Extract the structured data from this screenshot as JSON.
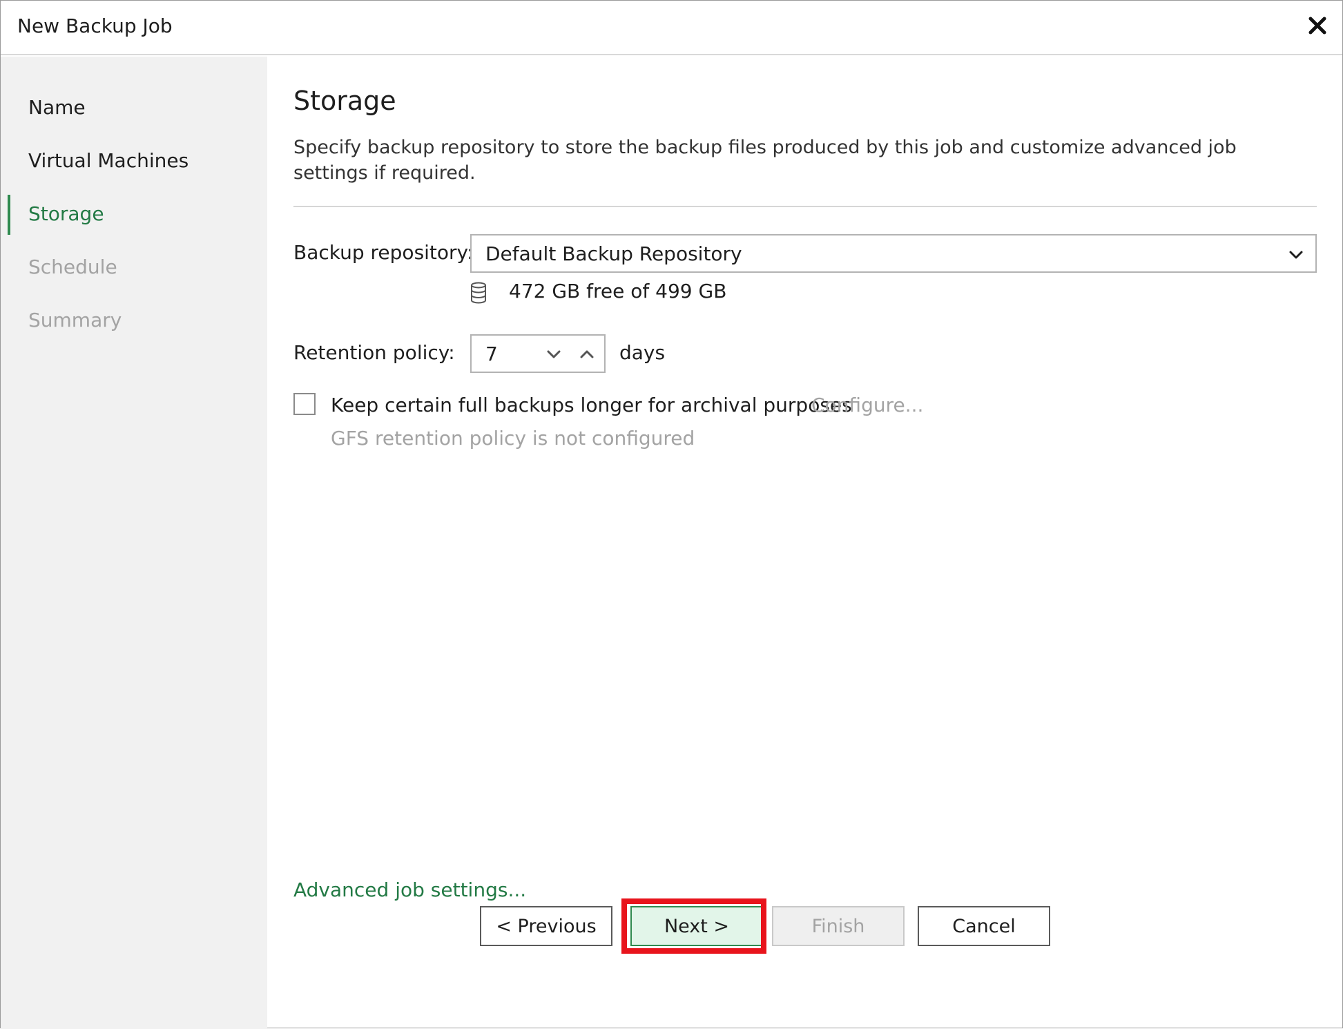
{
  "window": {
    "title": "New Backup Job",
    "close_icon": "close-icon"
  },
  "sidebar": {
    "steps": [
      {
        "label": "Name",
        "state": "done"
      },
      {
        "label": "Virtual Machines",
        "state": "done"
      },
      {
        "label": "Storage",
        "state": "active"
      },
      {
        "label": "Schedule",
        "state": "pending"
      },
      {
        "label": "Summary",
        "state": "pending"
      }
    ]
  },
  "main": {
    "heading": "Storage",
    "description": "Specify backup repository to store the backup files produced by this job and customize advanced job settings if required.",
    "repository": {
      "label": "Backup repository:",
      "value": "Default Backup Repository",
      "free_space": "472 GB free of 499 GB"
    },
    "retention": {
      "label": "Retention policy:",
      "value": "7",
      "unit": "days"
    },
    "gfs": {
      "checkbox_label": "Keep certain full backups longer for archival purposes",
      "checked": false,
      "configure_link": "Configure...",
      "status": "GFS retention policy is not configured"
    },
    "advanced_link": "Advanced job settings..."
  },
  "buttons": {
    "previous": "< Previous",
    "next": "Next >",
    "finish": "Finish",
    "cancel": "Cancel"
  },
  "colors": {
    "accent": "#237a45",
    "highlight": "#e8141c",
    "disabled_text": "#a3a3a3",
    "sidebar_bg": "#f1f1f1"
  }
}
